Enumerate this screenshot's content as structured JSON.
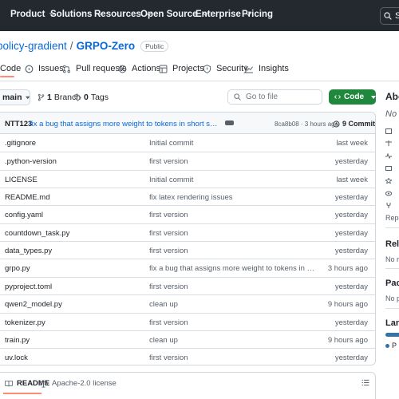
{
  "nav": {
    "items": [
      {
        "label": "Product",
        "has_menu": true
      },
      {
        "label": "Solutions",
        "has_menu": true
      },
      {
        "label": "Resources",
        "has_menu": true
      },
      {
        "label": "Open Source",
        "has_menu": true
      },
      {
        "label": "Enterprise",
        "has_menu": true
      },
      {
        "label": "Pricing",
        "has_menu": false
      }
    ],
    "search_label": "Se"
  },
  "repo": {
    "owner": "policy-gradient",
    "name": "GRPO-Zero",
    "visibility": "Public"
  },
  "tabs": [
    {
      "label": "Code",
      "icon": "code-icon",
      "active": true
    },
    {
      "label": "Issues",
      "icon": "issue-icon"
    },
    {
      "label": "Pull requests",
      "icon": "pull-request-icon"
    },
    {
      "label": "Actions",
      "icon": "play-icon"
    },
    {
      "label": "Projects",
      "icon": "table-icon"
    },
    {
      "label": "Security",
      "icon": "shield-icon"
    },
    {
      "label": "Insights",
      "icon": "graph-icon"
    }
  ],
  "toolbar": {
    "branch": "main",
    "branch_count": "1",
    "branch_label": "Branch",
    "tag_count": "0",
    "tag_label": "Tags",
    "goto_placeholder": "Go to file",
    "code_button": "Code"
  },
  "latest_commit": {
    "author": "NTT123",
    "message": "fix a bug that assigns more weight to tokens in short sequences than …",
    "sha_time": "8ca8b08 · 3 hours ago",
    "commit_count": "9 Commits"
  },
  "files": [
    {
      "name": ".gitignore",
      "message": "Initial commit",
      "date": "last week"
    },
    {
      "name": ".python-version",
      "message": "first version",
      "date": "yesterday"
    },
    {
      "name": "LICENSE",
      "message": "Initial commit",
      "date": "last week"
    },
    {
      "name": "README.md",
      "message": "fix latex rendering issues",
      "date": "yesterday"
    },
    {
      "name": "config.yaml",
      "message": "first version",
      "date": "yesterday"
    },
    {
      "name": "countdown_task.py",
      "message": "first version",
      "date": "yesterday"
    },
    {
      "name": "data_types.py",
      "message": "first version",
      "date": "yesterday"
    },
    {
      "name": "grpo.py",
      "message": "fix a bug that assigns more weight to tokens in short sequen…",
      "date": "3 hours ago"
    },
    {
      "name": "pyproject.toml",
      "message": "first version",
      "date": "yesterday"
    },
    {
      "name": "qwen2_model.py",
      "message": "clean up",
      "date": "9 hours ago"
    },
    {
      "name": "tokenizer.py",
      "message": "first version",
      "date": "yesterday"
    },
    {
      "name": "train.py",
      "message": "clean up",
      "date": "9 hours ago"
    },
    {
      "name": "uv.lock",
      "message": "first version",
      "date": "yesterday"
    }
  ],
  "readme_bar": {
    "readme_tab": "README",
    "license_tab": "Apache-2.0 license"
  },
  "sidebar": {
    "about": "Abo",
    "desc": "No d",
    "repo_small": "Repo",
    "releases": "Rele",
    "releases_note": "No re",
    "packages": "Pack",
    "packages_note": "No pa",
    "languages": "Lang",
    "lang_item": "P",
    "lang_color": "#3572A5"
  },
  "colors": {
    "nav_bg": "#24292f",
    "link": "#0969da",
    "primary_button": "#1f883d",
    "active_tab_underline": "#fd8c73"
  }
}
